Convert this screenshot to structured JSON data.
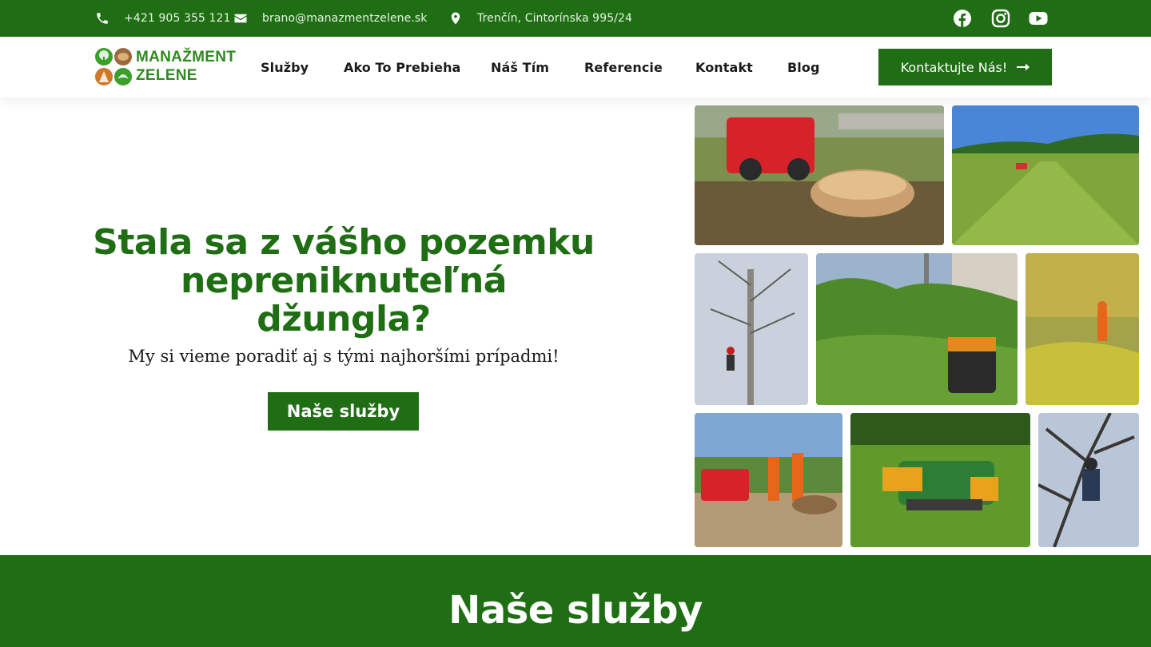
{
  "topbar": {
    "phone": "+421 905 355 121",
    "email": "brano@manazmentzelene.sk",
    "address": "Trenčín, Cintorínska 995/24",
    "social": [
      "facebook-icon",
      "instagram-icon",
      "youtube-icon"
    ]
  },
  "logo": {
    "line1": "MANAŽMENT",
    "line2": "ZELENE"
  },
  "nav": {
    "items": [
      "Služby",
      "Ako To Prebieha",
      "Náš Tím",
      "Referencie",
      "Kontakt",
      "Blog"
    ],
    "cta": "Kontaktujte Nás!"
  },
  "hero": {
    "title_lines": [
      "Stala sa z vášho pozemku",
      "nepreniknuteľná",
      "džungla?"
    ],
    "subtitle": "My si vieme poradiť aj s tými najhoršími prípadmi!",
    "button": "Naše služby"
  },
  "services": {
    "title": "Naše služby"
  },
  "colors": {
    "brand_green": "#1f6e14",
    "white": "#ffffff"
  }
}
